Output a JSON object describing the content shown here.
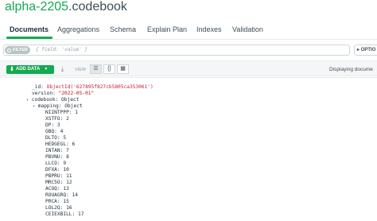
{
  "namespace": {
    "db": "alpha-2205",
    "collection": ".codebook"
  },
  "tabs": [
    {
      "label": "Documents",
      "active": true
    },
    {
      "label": "Aggregations"
    },
    {
      "label": "Schema"
    },
    {
      "label": "Explain Plan"
    },
    {
      "label": "Indexes"
    },
    {
      "label": "Validation"
    }
  ],
  "filter": {
    "tag": "FILTER",
    "placeholder": "{ field: 'value' }",
    "options_label": "OPTIO"
  },
  "toolbar": {
    "add_data": "ADD DATA",
    "view_label": "VIEW",
    "displaying": "Displaying docume"
  },
  "document": {
    "id_key": "_id:",
    "id_value": "ObjectId('627895f827cb5805ca353061')",
    "version_key": "version:",
    "version_value": "\"2022-05-01\"",
    "codebook_key": "codebook:",
    "codebook_type": "Object",
    "mapping_key": "mapping:",
    "mapping_type": "Object",
    "entries": [
      {
        "k": "NIINTPPP:",
        "v": "1"
      },
      {
        "k": "XSTFO:",
        "v": "2"
      },
      {
        "k": "DP:",
        "v": "3"
      },
      {
        "k": "OBQ:",
        "v": "4"
      },
      {
        "k": "DLTO:",
        "v": "5"
      },
      {
        "k": "HEDGEGL:",
        "v": "6"
      },
      {
        "k": "INTAN:",
        "v": "7"
      },
      {
        "k": "PBVNU:",
        "v": "8"
      },
      {
        "k": "LLCO:",
        "v": "9"
      },
      {
        "k": "DFXA:",
        "v": "10"
      },
      {
        "k": "PBPRU:",
        "v": "11"
      },
      {
        "k": "MRC5O:",
        "v": "12"
      },
      {
        "k": "ACOQ:",
        "v": "13"
      },
      {
        "k": "ROUAGRQ:",
        "v": "14"
      },
      {
        "k": "PRCA:",
        "v": "15"
      },
      {
        "k": "LOL2Q:",
        "v": "16"
      },
      {
        "k": "CEIEXBILL:",
        "v": "17"
      }
    ]
  }
}
